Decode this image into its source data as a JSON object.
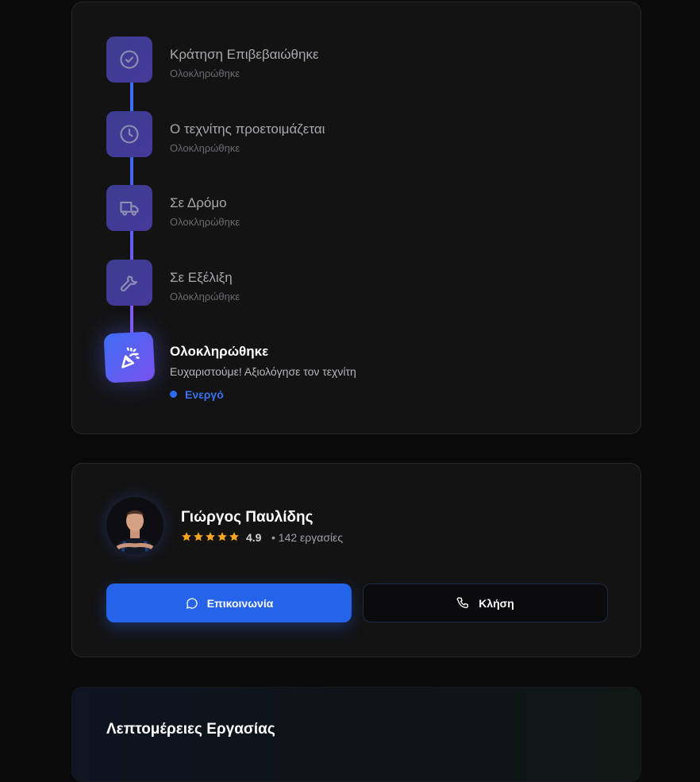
{
  "timeline": {
    "steps": [
      {
        "title": "Κράτηση Επιβεβαιώθηκε",
        "status": "Ολοκληρώθηκε",
        "icon": "check-circle-icon"
      },
      {
        "title": "Ο τεχνίτης προετοιμάζεται",
        "status": "Ολοκληρώθηκε",
        "icon": "clock-icon"
      },
      {
        "title": "Σε Δρόμο",
        "status": "Ολοκληρώθηκε",
        "icon": "truck-icon"
      },
      {
        "title": "Σε Εξέλιξη",
        "status": "Ολοκληρώθηκε",
        "icon": "wrench-icon"
      }
    ],
    "active": {
      "title": "Ολοκληρώθηκε",
      "subtitle": "Ευχαριστούμε! Αξιολόγησε τον τεχνίτη",
      "status": "Ενεργό",
      "icon": "party-popper-icon"
    }
  },
  "technician": {
    "name": "Γιώργος Παυλίδης",
    "stars": 5,
    "rating": "4.9",
    "jobs": "• 142 εργασίες",
    "contact_label": "Επικοινωνία",
    "call_label": "Κλήση"
  },
  "details": {
    "title": "Λεπτομέρειες Εργασίας"
  },
  "colors": {
    "accent": "#2563eb",
    "star": "#f5a524",
    "background": "#0a0a0b",
    "card": "#131314"
  }
}
